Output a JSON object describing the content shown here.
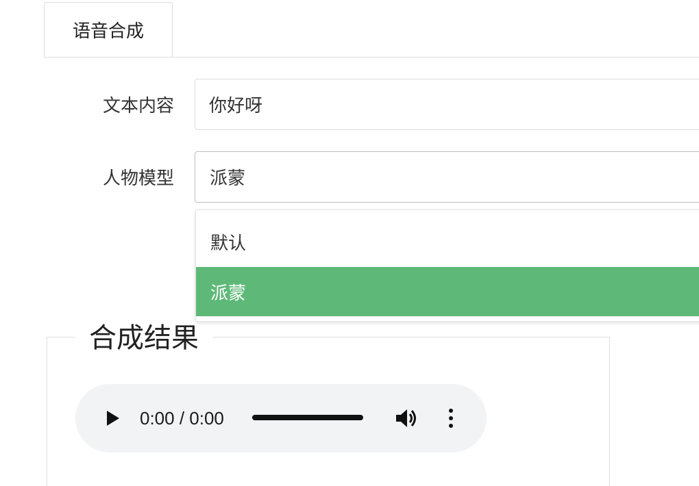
{
  "tabs": [
    {
      "label": "语音合成",
      "active": true
    }
  ],
  "form": {
    "text_label": "文本内容",
    "text_value": "你好呀",
    "model_label": "人物模型",
    "model_selected": "派蒙",
    "model_options": [
      {
        "label": "默认",
        "highlighted": false
      },
      {
        "label": "派蒙",
        "highlighted": true
      }
    ]
  },
  "result": {
    "title": "合成结果",
    "audio": {
      "time": "0:00 / 0:00",
      "icons": [
        "play-icon",
        "volume-icon",
        "more-options-icon"
      ]
    }
  },
  "colors": {
    "highlight": "#5eb978",
    "player_bg": "#f1f3f4",
    "border": "#dddddd"
  }
}
